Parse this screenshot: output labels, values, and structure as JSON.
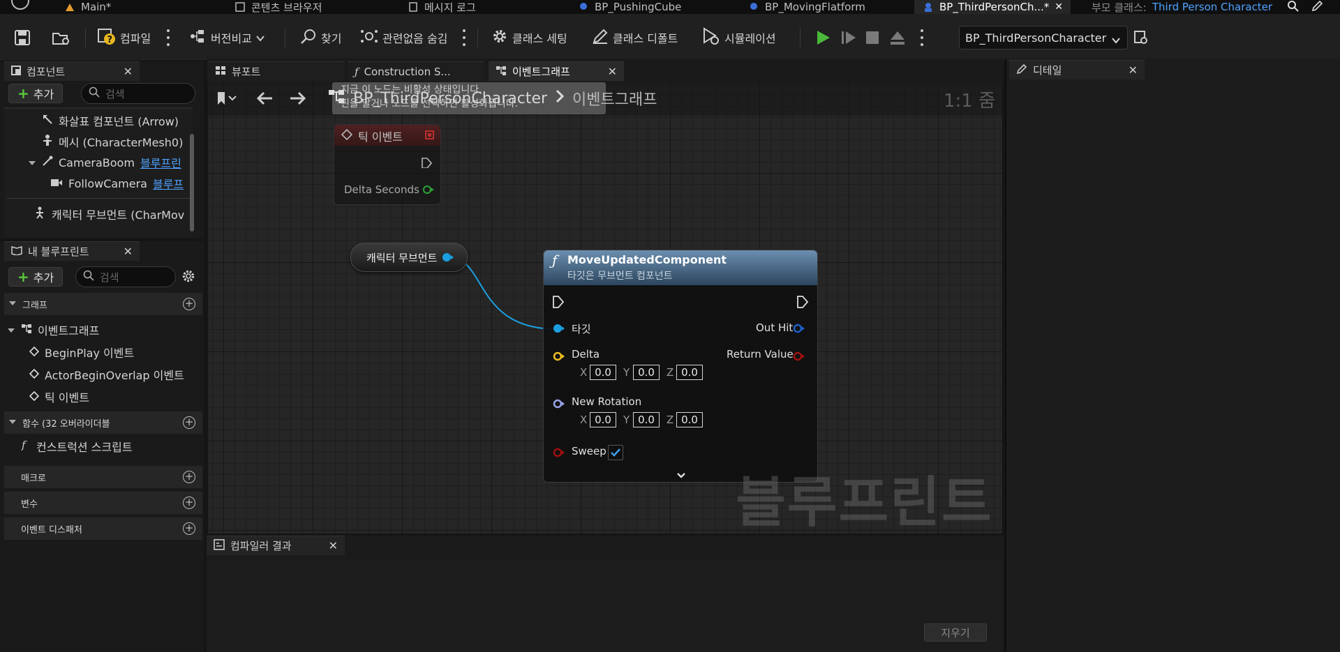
{
  "title_tabs": [
    {
      "label": "Main*"
    },
    {
      "label": "콘텐츠 브라우저"
    },
    {
      "label": "메시지 로그"
    },
    {
      "label": "BP_PushingCube"
    },
    {
      "label": "BP_MovingFlatform"
    },
    {
      "label": "BP_ThirdPersonCh...*"
    }
  ],
  "parent_class": {
    "label": "부모 클래스:",
    "value": "Third Person Character"
  },
  "toolbar": {
    "compile": "컴파일",
    "diff": "버전비교",
    "find": "찾기",
    "hide_unrelated": "관련없음 숨김",
    "class_settings": "클래스 세팅",
    "class_defaults": "클래스 디폴트",
    "simulation": "시뮬레이션",
    "debug_object": "BP_ThirdPersonCharacter"
  },
  "components_panel": {
    "title": "컴포넌트",
    "add_label": "추가",
    "search_placeholder": "검색",
    "items": [
      {
        "label": "화살표 컴포넌트 (Arrow)"
      },
      {
        "label": "메시 (CharacterMesh0)"
      },
      {
        "label": "CameraBoom",
        "link": "블루프린"
      },
      {
        "label": "FollowCamera",
        "link": "블루프"
      },
      {
        "label": "캐릭터 무브먼트 (CharMov"
      }
    ]
  },
  "my_blueprint": {
    "title": "내 블루프린트",
    "add_label": "추가",
    "search_placeholder": "검색",
    "graph_category": "그래프",
    "event_graph": "이벤트그래프",
    "events": [
      "BeginPlay 이벤트",
      "ActorBeginOverlap 이벤트",
      "틱 이벤트"
    ],
    "functions_category": "함수 (32 오버라이더블",
    "construction_script": "컨스트럭션 스크립트",
    "macros_category": "매크로",
    "variables_category": "변수",
    "dispatchers_category": "이벤트 디스패처"
  },
  "editor_tabs": [
    {
      "label": "뷰포트"
    },
    {
      "label": "Construction S..."
    },
    {
      "label": "이벤트그래프"
    }
  ],
  "graph": {
    "breadcrumb_root": "BP_ThirdPersonCharacter",
    "breadcrumb_current": "이벤트그래프",
    "zoom": "1:1 줌",
    "watermark": "블루프린트",
    "tooltip_line1": "지금 이 노드는 비활성 상태입니다.",
    "tooltip_line2": "핀을 달거나 노드를 선택하면 활성화됩니다.",
    "tick_node": {
      "title": "틱 이벤트",
      "pin": "Delta Seconds"
    },
    "var_node": {
      "label": "캐릭터 무브먼트"
    },
    "func_node": {
      "title": "MoveUpdatedComponent",
      "subtitle": "타깃은 무브먼트 컴포넌트",
      "target": "타깃",
      "out_hit": "Out Hit",
      "delta": "Delta",
      "return_value": "Return Value",
      "new_rotation": "New Rotation",
      "sweep": "Sweep",
      "delta_x": "0.0",
      "delta_y": "0.0",
      "delta_z": "0.0",
      "rot_x": "0.0",
      "rot_y": "0.0",
      "rot_z": "0.0",
      "axis_x": "X",
      "axis_y": "Y",
      "axis_z": "Z"
    }
  },
  "compiler": {
    "title": "컴파일러 결과",
    "clear_label": "지우기"
  },
  "details": {
    "title": "디테일"
  },
  "colors": {
    "accent": "#4ea3ff",
    "play": "#4bb73a",
    "exec_wire": "#1b9fe0",
    "tick_header": "#5a2020"
  }
}
